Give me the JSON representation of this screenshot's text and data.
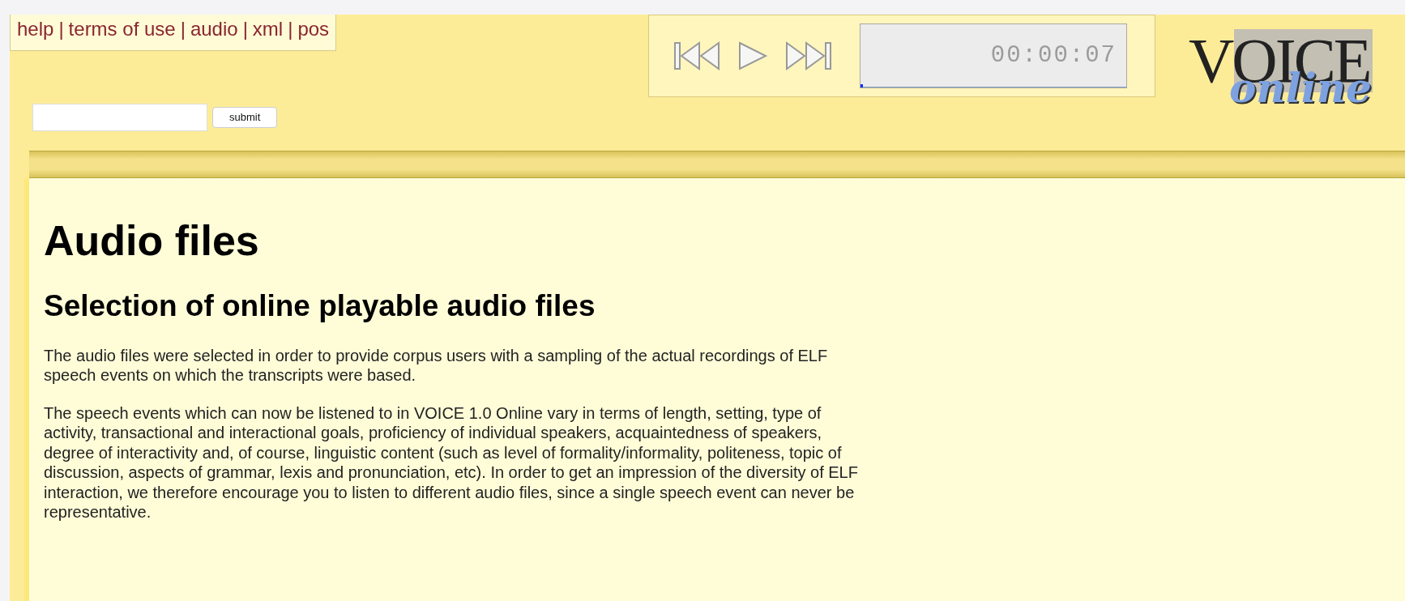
{
  "nav_links": [
    {
      "kind": "link",
      "text": "help"
    },
    {
      "kind": "separator",
      "text": "|"
    },
    {
      "kind": "link",
      "text": "terms of use"
    },
    {
      "kind": "separator",
      "text": "|"
    },
    {
      "kind": "link",
      "text": "audio"
    },
    {
      "kind": "separator",
      "text": "|"
    },
    {
      "kind": "link",
      "text": "xml"
    },
    {
      "kind": "separator",
      "text": "|"
    },
    {
      "kind": "link",
      "text": "pos"
    }
  ],
  "player": {
    "time": "00:00:07",
    "level": 0.01
  },
  "logo": {
    "word": "VOICE",
    "tagline": "online"
  },
  "search": {
    "button": "submit"
  },
  "content": {
    "title": "Audio files",
    "subtitle": "Selection of online playable audio files",
    "paragraphs": [
      "The audio files were selected in order to provide corpus users with a sampling of the actual recordings of ELF speech events on which the transcripts were based.",
      "The speech events which can now be listened to in VOICE 1.0 Online vary in terms of length, setting, type of activity, transactional and interactional goals, proficiency of individual speakers, acquaintedness of speakers, degree of interactivity and, of course, linguistic content (such as level of formality/informality, politeness, topic of discussion, aspects of grammar, lexis and pronunciation, etc). In order to get an impression of the diversity of ELF interaction, we therefore encourage you to listen to different audio files, since a single speech event can never be representative."
    ]
  }
}
